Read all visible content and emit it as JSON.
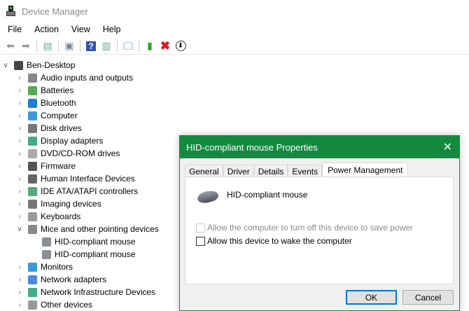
{
  "window": {
    "title": "Device Manager"
  },
  "menu": [
    "File",
    "Action",
    "View",
    "Help"
  ],
  "toolbar": {
    "icons": [
      "back-icon",
      "forward-icon",
      "show-hide-console-tree-icon",
      "properties-icon",
      "help-icon",
      "action-pane-icon",
      "scan-hardware-icon",
      "update-driver-icon",
      "uninstall-icon",
      "disable-device-icon"
    ]
  },
  "tree": {
    "root": "Ben-Desktop",
    "items": [
      {
        "label": "Audio inputs and outputs",
        "color": "#888"
      },
      {
        "label": "Batteries",
        "color": "#5a5"
      },
      {
        "label": "Bluetooth",
        "color": "#1e7ed8"
      },
      {
        "label": "Computer",
        "color": "#3a9ad9"
      },
      {
        "label": "Disk drives",
        "color": "#777"
      },
      {
        "label": "Display adapters",
        "color": "#4a8"
      },
      {
        "label": "DVD/CD-ROM drives",
        "color": "#aaa"
      },
      {
        "label": "Firmware",
        "color": "#555"
      },
      {
        "label": "Human Interface Devices",
        "color": "#666"
      },
      {
        "label": "IDE ATA/ATAPI controllers",
        "color": "#5a7"
      },
      {
        "label": "Imaging devices",
        "color": "#777"
      },
      {
        "label": "Keyboards",
        "color": "#999"
      },
      {
        "label": "Mice and other pointing devices",
        "color": "#888",
        "expanded": true,
        "children": [
          "HID-compliant mouse",
          "HID-compliant mouse"
        ]
      },
      {
        "label": "Monitors",
        "color": "#3a9ad9"
      },
      {
        "label": "Network adapters",
        "color": "#4a8ad9"
      },
      {
        "label": "Network Infrastructure Devices",
        "color": "#4a8"
      },
      {
        "label": "Other devices",
        "color": "#999"
      }
    ]
  },
  "dialog": {
    "title": "HID-compliant mouse Properties",
    "tabs": [
      "General",
      "Driver",
      "Details",
      "Events",
      "Power Management"
    ],
    "active_tab": "Power Management",
    "device_name": "HID-compliant mouse",
    "options": [
      {
        "label": "Allow the computer to turn off this device to save power",
        "checked": false,
        "disabled": true
      },
      {
        "label": "Allow this device to wake the computer",
        "checked": false,
        "disabled": false
      }
    ],
    "ok": "OK",
    "cancel": "Cancel"
  },
  "colors": {
    "dialog_accent": "#138a3e",
    "focus": "#0078d7"
  }
}
